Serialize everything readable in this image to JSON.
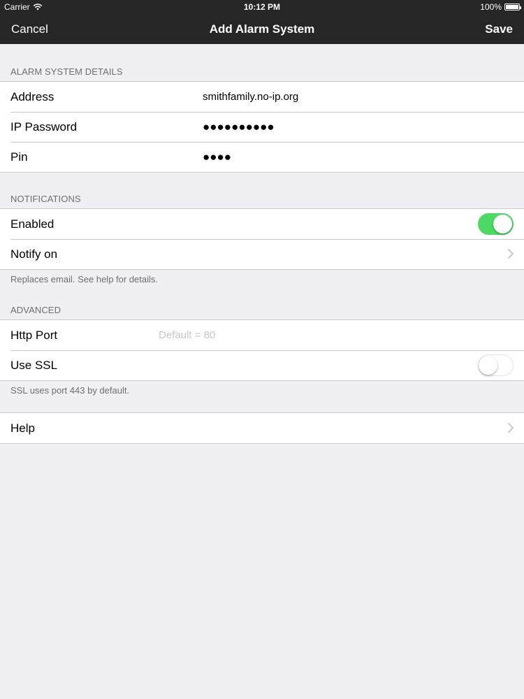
{
  "status_bar": {
    "carrier": "Carrier",
    "time": "10:12 PM",
    "battery": "100%"
  },
  "nav": {
    "cancel_label": "Cancel",
    "title": "Add Alarm System",
    "save_label": "Save"
  },
  "alarm_details": {
    "header": "ALARM SYSTEM DETAILS",
    "address_label": "Address",
    "address_value": "smithfamily.no-ip.org",
    "ip_password_label": "IP Password",
    "ip_password_value": "●●●●●●●●●●",
    "pin_label": "Pin",
    "pin_value": "●●●●"
  },
  "notifications": {
    "header": "NOTIFICATIONS",
    "enabled_label": "Enabled",
    "enabled": true,
    "notify_on_label": "Notify on",
    "footer": "Replaces email. See help for details."
  },
  "advanced": {
    "header": "ADVANCED",
    "http_port_label": "Http Port",
    "http_port_placeholder": "Default = 80",
    "use_ssl_label": "Use SSL",
    "use_ssl": false,
    "footer": "SSL uses port 443 by default."
  },
  "help": {
    "label": "Help"
  },
  "colors": {
    "nav_background": "#262626",
    "toggle_on": "#4cd964",
    "page_background": "#efeff4"
  }
}
